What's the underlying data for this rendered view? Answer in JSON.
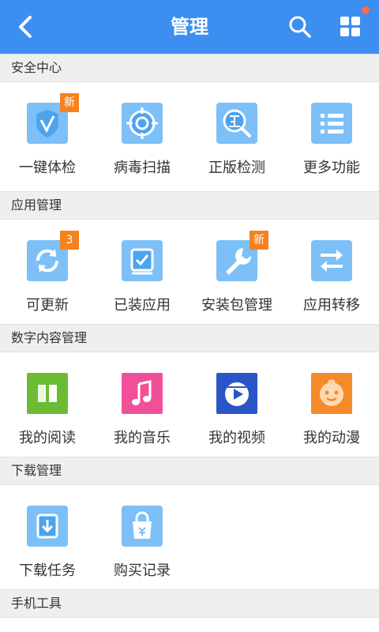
{
  "header": {
    "title": "管理"
  },
  "colors": {
    "accent": "#3c8ff0",
    "badge": "#f5821f",
    "notify_dot": "#ff6a4a"
  },
  "sections": [
    {
      "title": "安全中心",
      "items": [
        {
          "label": "一键体检",
          "icon": "shield-check-icon",
          "badge": "新"
        },
        {
          "label": "病毒扫描",
          "icon": "virus-scan-icon",
          "badge": ""
        },
        {
          "label": "正版检测",
          "icon": "genuine-check-icon",
          "badge": ""
        },
        {
          "label": "更多功能",
          "icon": "more-list-icon",
          "badge": ""
        }
      ]
    },
    {
      "title": "应用管理",
      "items": [
        {
          "label": "可更新",
          "icon": "refresh-icon",
          "badge": "3"
        },
        {
          "label": "已装应用",
          "icon": "installed-apps-icon",
          "badge": ""
        },
        {
          "label": "安装包管理",
          "icon": "wrench-icon",
          "badge": "新"
        },
        {
          "label": "应用转移",
          "icon": "transfer-icon",
          "badge": ""
        }
      ]
    },
    {
      "title": "数字内容管理",
      "items": [
        {
          "label": "我的阅读",
          "icon": "book-icon",
          "badge": ""
        },
        {
          "label": "我的音乐",
          "icon": "music-icon",
          "badge": ""
        },
        {
          "label": "我的视频",
          "icon": "video-icon",
          "badge": ""
        },
        {
          "label": "我的动漫",
          "icon": "anime-icon",
          "badge": ""
        }
      ]
    },
    {
      "title": "下载管理",
      "items": [
        {
          "label": "下载任务",
          "icon": "download-icon",
          "badge": ""
        },
        {
          "label": "购买记录",
          "icon": "purchase-bag-icon",
          "badge": ""
        }
      ]
    },
    {
      "title": "手机工具",
      "items": []
    }
  ]
}
